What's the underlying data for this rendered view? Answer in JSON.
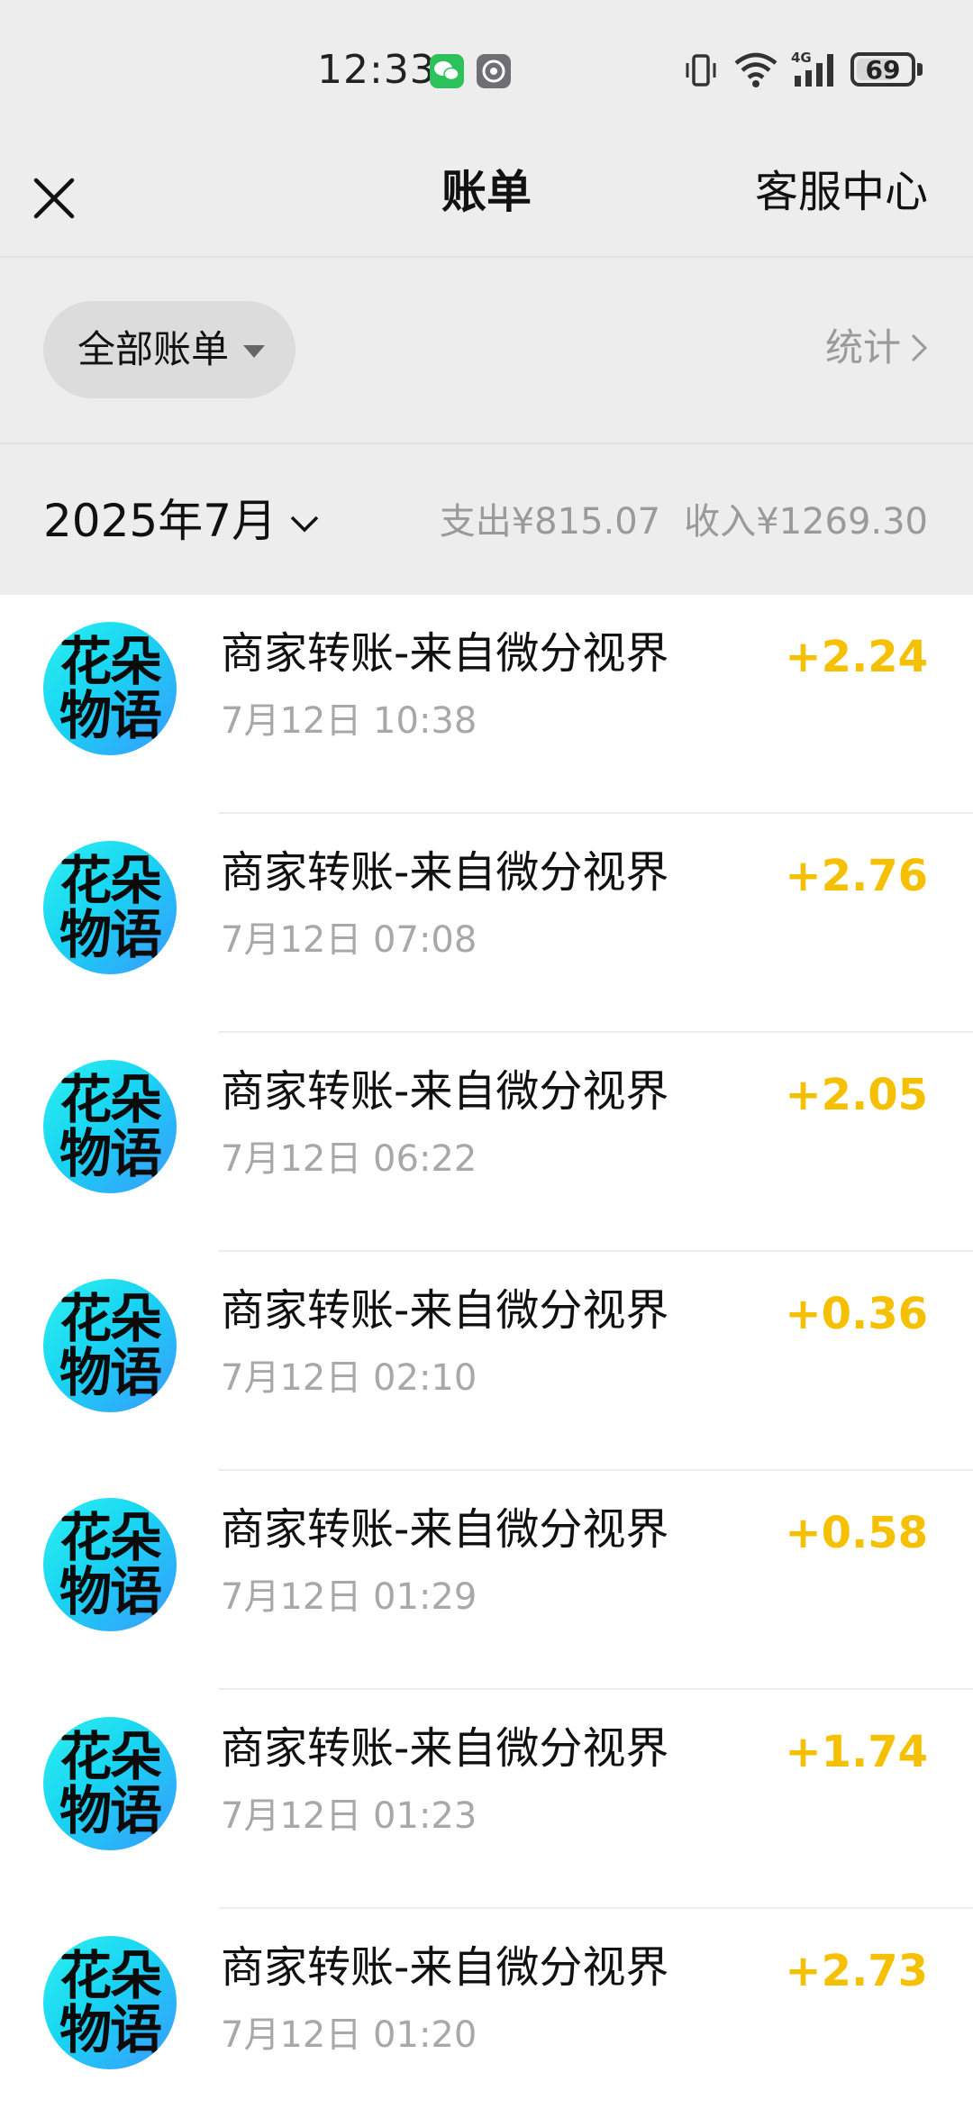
{
  "status_bar": {
    "time": "12:33",
    "battery": "69",
    "battery_level": 0.69,
    "icons": [
      "wechat-icon",
      "settings-icon",
      "vibrate-icon",
      "wifi-icon",
      "signal-4g-icon",
      "battery-icon"
    ]
  },
  "nav": {
    "title": "账单",
    "service_label": "客服中心",
    "close_icon": "close-icon"
  },
  "filter": {
    "label": "全部账单",
    "stats_label": "统计"
  },
  "month": {
    "label": "2025年7月",
    "expense_label": "支出",
    "expense_value": "¥815.07",
    "income_label": "收入",
    "income_value": "¥1269.30"
  },
  "colors": {
    "income_amount": "#f5c000",
    "background_header": "#ededed",
    "avatar_cyan": "#18d4f2"
  },
  "transactions": [
    {
      "avatar_line1": "花朵",
      "avatar_line2": "物语",
      "title": "商家转账-来自微分视界",
      "time": "7月12日 10:38",
      "amount": "+2.24"
    },
    {
      "avatar_line1": "花朵",
      "avatar_line2": "物语",
      "title": "商家转账-来自微分视界",
      "time": "7月12日 07:08",
      "amount": "+2.76"
    },
    {
      "avatar_line1": "花朵",
      "avatar_line2": "物语",
      "title": "商家转账-来自微分视界",
      "time": "7月12日 06:22",
      "amount": "+2.05"
    },
    {
      "avatar_line1": "花朵",
      "avatar_line2": "物语",
      "title": "商家转账-来自微分视界",
      "time": "7月12日 02:10",
      "amount": "+0.36"
    },
    {
      "avatar_line1": "花朵",
      "avatar_line2": "物语",
      "title": "商家转账-来自微分视界",
      "time": "7月12日 01:29",
      "amount": "+0.58"
    },
    {
      "avatar_line1": "花朵",
      "avatar_line2": "物语",
      "title": "商家转账-来自微分视界",
      "time": "7月12日 01:23",
      "amount": "+1.74"
    },
    {
      "avatar_line1": "花朵",
      "avatar_line2": "物语",
      "title": "商家转账-来自微分视界",
      "time": "7月12日 01:20",
      "amount": "+2.73"
    }
  ]
}
